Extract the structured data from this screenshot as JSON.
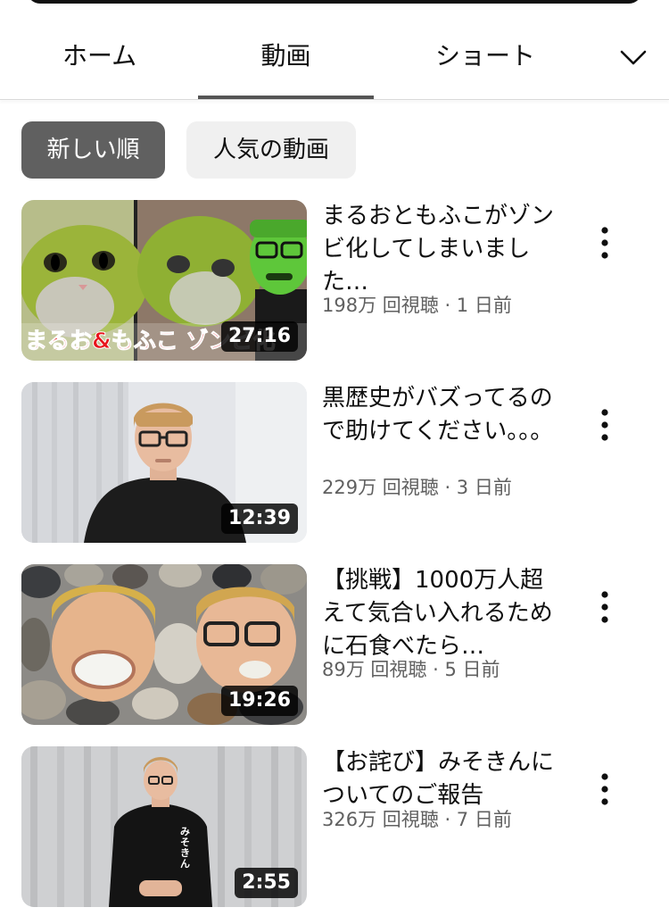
{
  "tabs": [
    {
      "label": "ホーム",
      "selected": false
    },
    {
      "label": "動画",
      "selected": true
    },
    {
      "label": "ショート",
      "selected": false
    }
  ],
  "more_tabs_icon": "chevron-down-icon",
  "filters": [
    {
      "label": "新しい順",
      "selected": true
    },
    {
      "label": "人気の動画",
      "selected": false
    }
  ],
  "videos": [
    {
      "title": "まるおともふこがゾンビ化してしまいました…",
      "views": "198万 回視聴",
      "age": "1 日前",
      "duration": "27:16",
      "thumb_caption": "まるお&もふこ ゾンビ化"
    },
    {
      "title": "黒歴史がバズってるので助けてください。。。",
      "views": "229万 回視聴",
      "age": "3 日前",
      "duration": "12:39"
    },
    {
      "title": "【挑戦】1000万人超えて気合い入れるために石食べたら…",
      "views": "89万 回視聴",
      "age": "5 日前",
      "duration": "19:26"
    },
    {
      "title": "【お詫び】みそきんについてのご報告",
      "views": "326万 回視聴",
      "age": "7 日前",
      "duration": "2:55",
      "shirt_text": "みそきん"
    }
  ],
  "meta_separator": " · ",
  "colors": {
    "active_chip": "#606060",
    "inactive_chip": "#f0f0f0",
    "meta_text": "#606060",
    "tab_indicator": "#555555"
  }
}
